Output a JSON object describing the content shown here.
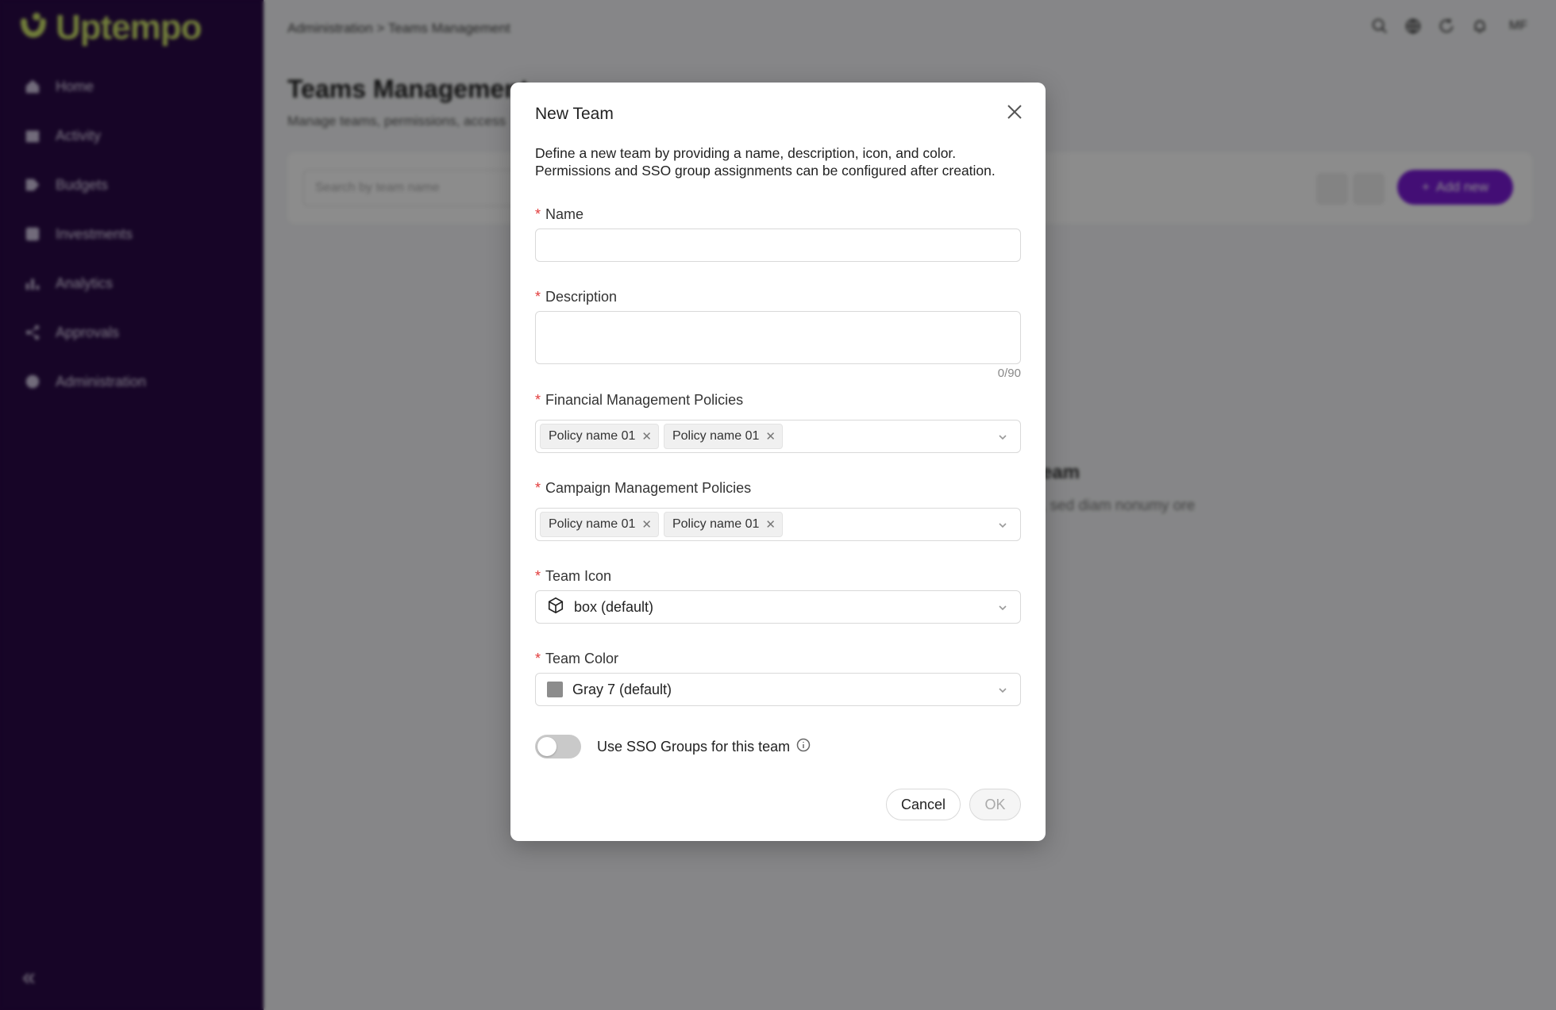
{
  "app": {
    "logo_text": "Uptempo"
  },
  "sidebar": {
    "items": [
      {
        "label": "Home",
        "icon": "home-icon"
      },
      {
        "label": "Activity",
        "icon": "calendar-icon"
      },
      {
        "label": "Budgets",
        "icon": "budget-icon"
      },
      {
        "label": "Investments",
        "icon": "investments-icon"
      },
      {
        "label": "Analytics",
        "icon": "chart-icon"
      },
      {
        "label": "Approvals",
        "icon": "share-icon"
      },
      {
        "label": "Administration",
        "icon": "gear-icon"
      }
    ],
    "collapse_glyph": "«"
  },
  "header": {
    "breadcrumb": "Administration > Teams Management",
    "avatar": "MF"
  },
  "page": {
    "title": "Teams Management",
    "subtitle": "Manage teams, permissions, access",
    "search_placeholder": "Search by team name",
    "add_label": "Add new",
    "add_glyph": "+",
    "empty_title": "eam",
    "empty_text": ", sed diam nonumy ore"
  },
  "modal": {
    "title": "New Team",
    "description": "Define a new team by providing a name, description, icon, and color. Permissions and SSO group assignments can be configured after creation.",
    "required_mark": "*",
    "name": {
      "label": "Name",
      "value": ""
    },
    "description_field": {
      "label": "Description",
      "value": "",
      "counter": "0/90"
    },
    "financial": {
      "label": "Financial Management Policies",
      "tags": [
        "Policy name 01",
        "Policy name 01"
      ]
    },
    "campaign": {
      "label": "Campaign Management Policies",
      "tags": [
        "Policy name 01",
        "Policy name 01"
      ]
    },
    "team_icon": {
      "label": "Team Icon",
      "value": "box (default)"
    },
    "team_color": {
      "label": "Team Color",
      "value": "Gray 7 (default)",
      "swatch": "#8c8c8c"
    },
    "sso": {
      "label": "Use SSO Groups for this team",
      "enabled": false
    },
    "cancel_label": "Cancel",
    "ok_label": "OK",
    "tag_remove_glyph": "✕"
  },
  "colors": {
    "sidebar_bg": "#2a0a47",
    "accent": "#7a1bd6",
    "logo": "#cde36a",
    "required": "#e23b3b"
  }
}
